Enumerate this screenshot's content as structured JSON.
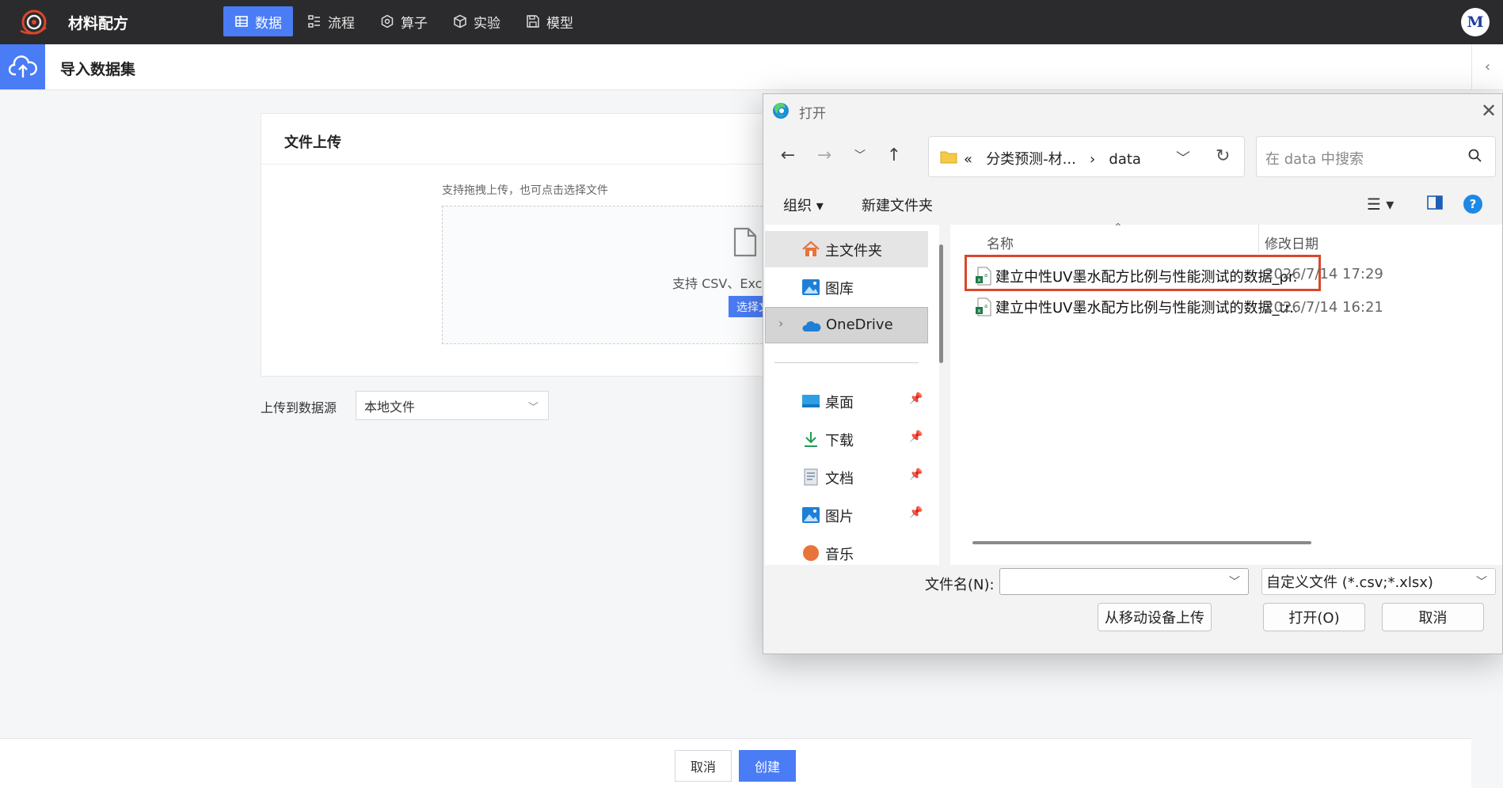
{
  "app": {
    "title": "材料配方",
    "avatar": "M"
  },
  "nav": [
    {
      "label": "数据",
      "icon": "table-icon",
      "active": true
    },
    {
      "label": "流程",
      "icon": "flow-icon",
      "active": false
    },
    {
      "label": "算子",
      "icon": "operator-icon",
      "active": false
    },
    {
      "label": "实验",
      "icon": "cube-icon",
      "active": false
    },
    {
      "label": "模型",
      "icon": "save-icon",
      "active": false
    }
  ],
  "page": {
    "title": "导入数据集"
  },
  "upload_card": {
    "title": "文件上传",
    "hint": "支持拖拽上传，也可点击选择文件",
    "dropzone_text": "支持 CSV、Exce",
    "choose_label": "选择文件"
  },
  "source": {
    "label": "上传到数据源",
    "value": "本地文件"
  },
  "footer": {
    "cancel": "取消",
    "create": "创建"
  },
  "dialog": {
    "title": "打开",
    "address": {
      "prefix": "«",
      "path1": "分类预测-材...",
      "sep": "›",
      "path2": "data"
    },
    "search_placeholder": "在 data 中搜索",
    "toolbar": {
      "organize": "组织 ▾",
      "new_folder": "新建文件夹"
    },
    "nav_pane": [
      {
        "label": "主文件夹",
        "icon": "home-icon"
      },
      {
        "label": "图库",
        "icon": "gallery-icon"
      },
      {
        "label": "OneDrive",
        "icon": "cloud-icon"
      },
      {
        "label": "桌面",
        "icon": "desktop-icon"
      },
      {
        "label": "下载",
        "icon": "download-icon"
      },
      {
        "label": "文档",
        "icon": "document-icon"
      },
      {
        "label": "图片",
        "icon": "picture-icon"
      },
      {
        "label": "音乐",
        "icon": "music-icon"
      }
    ],
    "columns": {
      "name": "名称",
      "date": "修改日期"
    },
    "files": [
      {
        "name": "建立中性UV墨水配方比例与性能测试的数据_pr...",
        "date": "2026/7/14 17:29"
      },
      {
        "name": "建立中性UV墨水配方比例与性能测试的数据_tr...",
        "date": "2026/7/14 16:21"
      }
    ],
    "filename_label": "文件名(N):",
    "filename_value": "",
    "filetype": "自定义文件 (*.csv;*.xlsx)",
    "buttons": {
      "mobile": "从移动设备上传",
      "open": "打开(O)",
      "cancel": "取消"
    }
  }
}
